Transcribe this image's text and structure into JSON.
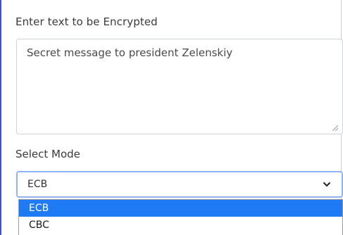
{
  "form": {
    "text_label": "Enter text to be Encrypted",
    "text_value": "Secret message to president Zelenskiy",
    "mode_label": "Select Mode",
    "mode_selected": "ECB",
    "mode_options": [
      {
        "label": "ECB",
        "highlighted": true
      },
      {
        "label": "CBC",
        "highlighted": false
      }
    ]
  },
  "colors": {
    "accent_border": "#3b4fd8",
    "focus_ring": "#8fb4f5",
    "option_highlight": "#1f7bf3"
  },
  "icons": {
    "select_arrow": "chevron-down-icon",
    "textarea_grip": "resize-grip-icon"
  }
}
